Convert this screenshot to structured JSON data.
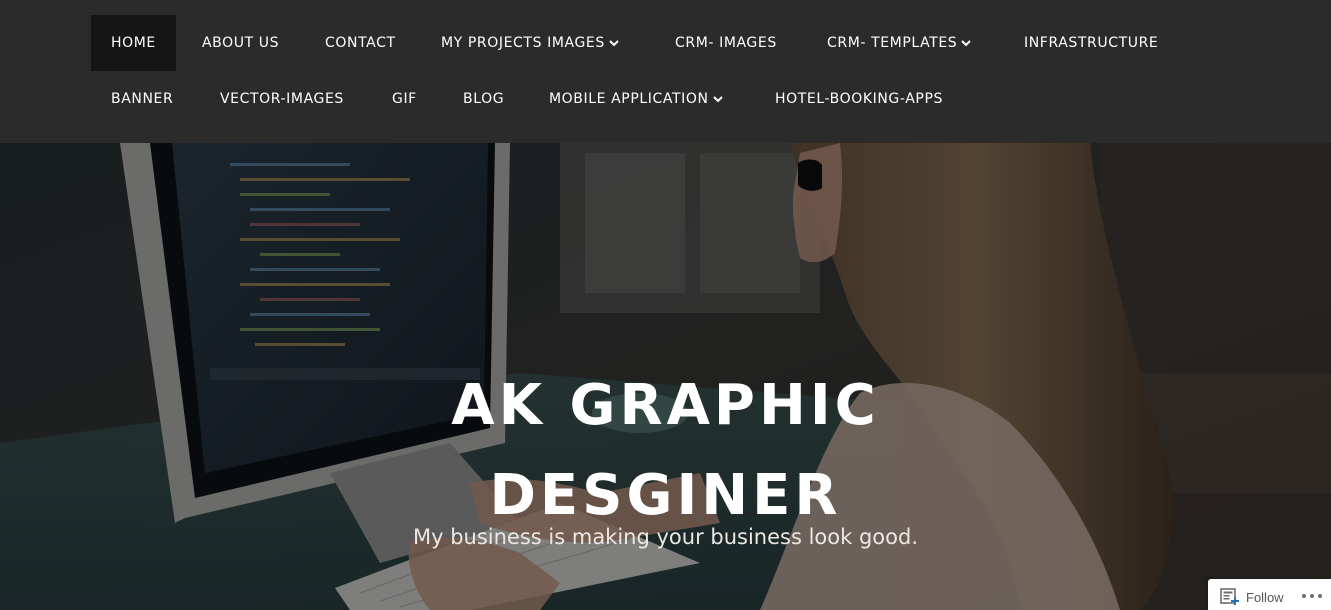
{
  "nav": {
    "items": [
      {
        "label": "HOME",
        "active": true
      },
      {
        "label": "ABOUT US"
      },
      {
        "label": "CONTACT"
      },
      {
        "label": "MY PROJECTS IMAGES",
        "dropdown": true
      },
      {
        "label": "CRM- IMAGES"
      },
      {
        "label": "CRM- TEMPLATES",
        "dropdown": true
      },
      {
        "label": "INFRASTRUCTURE"
      },
      {
        "label": "BANNER"
      },
      {
        "label": "VECTOR-IMAGES"
      },
      {
        "label": "GIF"
      },
      {
        "label": "BLOG"
      },
      {
        "label": "MOBILE APPLICATION",
        "dropdown": true
      },
      {
        "label": "HOTEL-BOOKING-APPS"
      }
    ]
  },
  "hero": {
    "title_line1": "AK GRAPHIC",
    "title_line2": "DESGINER",
    "tagline": "My business is making your business look good."
  },
  "follow_widget": {
    "label": "Follow",
    "icon": "reader-follow-icon",
    "more_icon": "ellipsis-icon"
  },
  "colors": {
    "nav_background": "#2b2b2b",
    "nav_active_background": "#151515",
    "text": "#ffffff"
  }
}
